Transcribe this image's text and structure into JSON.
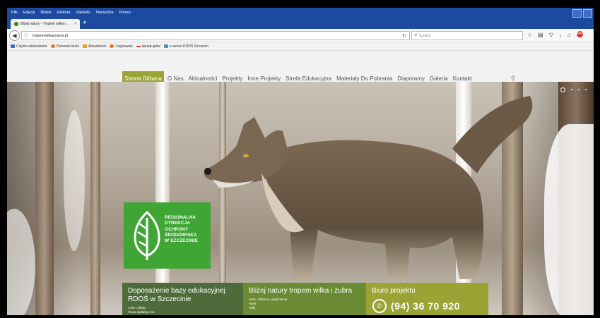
{
  "browser": {
    "menu": [
      "Plik",
      "Edycja",
      "Widok",
      "Historia",
      "Zakładki",
      "Narzędzia",
      "Pomoc"
    ],
    "tab_title": "Bliżej natury - Tropem wilka i ...",
    "tab_close": "×",
    "new_tab": "+",
    "url": "tropemwilkaizubra.pl",
    "search_placeholder": "Szukaj",
    "bookmarks": [
      {
        "label": "Często odwiedzane",
        "color": "#3b6fd0"
      },
      {
        "label": "Pierwsze kroki",
        "color": "#e07b1a"
      },
      {
        "label": "Aktualności",
        "color": "#e6a317"
      },
      {
        "label": "Logowanie",
        "color": "#e07b1a"
      },
      {
        "label": "epuap-gdos",
        "color": "#cc3a2a"
      },
      {
        "label": "e-servis RDOŚ Szczecin",
        "color": "#4a90d9"
      }
    ]
  },
  "site": {
    "nav": [
      "Strona Główna",
      "O Nas",
      "Aktualności",
      "Projekty",
      "Inne Projekty",
      "Strefa Edukacyjna",
      "Materiały Do Pobrania",
      "Diaporamy",
      "Galeria",
      "Kontakt"
    ],
    "logo_lines": [
      "REGIONALNA",
      "DYREKCJA",
      "OCHRONY",
      "ŚRODOWISKA",
      "W SZCZECINIE"
    ],
    "box1": {
      "title": "Doposażenie bazy edukacyjnej RDOŚ w Szczecinie",
      "items": [
        "cele i efekty",
        "baza dydaktyczna"
      ]
    },
    "box2": {
      "title": "Bliżej natury tropem wilka i żubra",
      "items": [
        "cele, odbiorcy, wydarzenia",
        "żubr",
        "wilk"
      ]
    },
    "box3": {
      "title": "Biuro projektu",
      "phone": "(94) 36 70 920"
    }
  }
}
